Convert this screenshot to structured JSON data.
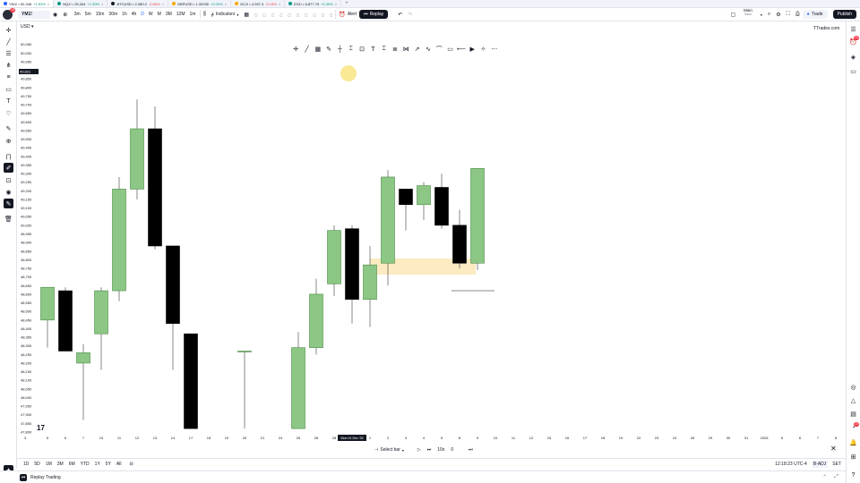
{
  "browser_tabs": [
    {
      "symbol": "YM1!",
      "price": "52,346",
      "change": "+1.83%",
      "color": "#2962ff",
      "neg": false
    },
    {
      "symbol": "NQ1!",
      "price": "25,344",
      "change": "+1.59%",
      "color": "#089981",
      "neg": false
    },
    {
      "symbol": "BTCUSD",
      "price": "2,380.2",
      "change": "-2.89%",
      "color": "#131722",
      "neg": true
    },
    {
      "symbol": "GBPUSD",
      "price": "1.32035",
      "change": "+0.02%",
      "color": "#f7a600",
      "neg": false
    },
    {
      "symbol": "GC1!",
      "price": "4,397.3",
      "change": "-0.13%",
      "color": "#f7a600",
      "neg": true
    },
    {
      "symbol": "ES1!",
      "price": "6,877.75",
      "change": "+0.39%",
      "color": "#089981",
      "neg": false
    }
  ],
  "toolbar": {
    "avatar_badge": "15",
    "symbol": "YM1!",
    "timeframes": [
      "3m",
      "5m",
      "15m",
      "30m",
      "1h",
      "4h",
      "D",
      "W",
      "M",
      "3M",
      "12M",
      "1m"
    ],
    "active_timeframe": "D",
    "indicators_label": "Indicators",
    "alert_label": "Alert",
    "replay_label": "Replay",
    "layout_name": "Main",
    "layout_sub": "Save",
    "trade_label": "Trade",
    "publish_label": "Publish"
  },
  "chart": {
    "currency": "USD",
    "watermark": "TTrades.com",
    "price_marker": "49,831",
    "date_marker": "Mon 01 Dec '25",
    "y_labels": [
      "50,050",
      "50,000",
      "49,950",
      "49,900",
      "49,850",
      "49,800",
      "49,750",
      "49,700",
      "49,650",
      "49,600",
      "49,550",
      "49,500",
      "49,450",
      "49,400",
      "49,350",
      "49,300",
      "49,250",
      "49,200",
      "49,150",
      "49,100",
      "49,050",
      "49,000",
      "48,950",
      "48,900",
      "48,850",
      "48,800",
      "48,750",
      "48,700",
      "48,650",
      "48,600",
      "48,550",
      "48,500",
      "48,450",
      "48,400",
      "48,350",
      "48,300",
      "48,250",
      "48,200",
      "48,150",
      "48,100",
      "48,050",
      "48,000",
      "47,950",
      "47,900",
      "47,850",
      "47,800"
    ],
    "x_labels": [
      "3",
      "5",
      "6",
      "7",
      "10",
      "11",
      "12",
      "13",
      "14",
      "17",
      "18",
      "19",
      "20",
      "21",
      "24",
      "25",
      "26",
      "28",
      "1",
      "2",
      "3",
      "4",
      "5",
      "8",
      "9",
      "10",
      "11",
      "12",
      "15",
      "16",
      "17",
      "18",
      "19",
      "22",
      "23",
      "24",
      "26",
      "29",
      "30",
      "31",
      "2026",
      "5",
      "6",
      "7",
      "8",
      "9"
    ],
    "x_label_positions": [
      28,
      53,
      73,
      93,
      113,
      133,
      153,
      173,
      193,
      213,
      233,
      253,
      273,
      293,
      313,
      333,
      353,
      373,
      413,
      433,
      453,
      473,
      493,
      513,
      533,
      553,
      573,
      593,
      613,
      633,
      653,
      673,
      693,
      713,
      733,
      753,
      773,
      793,
      813,
      833,
      853,
      873,
      893,
      913,
      933
    ]
  },
  "chart_data": {
    "type": "candlestick",
    "ylim": [
      47800,
      50100
    ],
    "candles": [
      {
        "open": 48450,
        "high": 48620,
        "low": 48290,
        "close": 48640,
        "bull": true
      },
      {
        "open": 48620,
        "high": 48640,
        "low": 48310,
        "close": 48270,
        "bull": false
      },
      {
        "open": 48200,
        "high": 48310,
        "low": 47870,
        "close": 48260,
        "bull": true
      },
      {
        "open": 48370,
        "high": 48640,
        "low": 48160,
        "close": 48620,
        "bull": true
      },
      {
        "open": 48620,
        "high": 49280,
        "low": 48560,
        "close": 49210,
        "bull": true
      },
      {
        "open": 49210,
        "high": 49730,
        "low": 49150,
        "close": 49560,
        "bull": true
      },
      {
        "open": 49560,
        "high": 49690,
        "low": 48860,
        "close": 48880,
        "bull": false
      },
      {
        "open": 48880,
        "high": 48880,
        "low": 48160,
        "close": 48430,
        "bull": false
      },
      {
        "open": 48370,
        "high": 48370,
        "low": 47820,
        "close": 47820,
        "bull": false
      },
      {
        "open": 48270,
        "high": 48270,
        "low": 47820,
        "close": 48270,
        "bull": true
      },
      {
        "open": 47820,
        "high": 48380,
        "low": 47820,
        "close": 48290,
        "bull": true
      },
      {
        "open": 48290,
        "high": 48690,
        "low": 48250,
        "close": 48600,
        "bull": true
      },
      {
        "open": 48660,
        "high": 49000,
        "low": 48590,
        "close": 48970,
        "bull": true
      },
      {
        "open": 48980,
        "high": 49000,
        "low": 48430,
        "close": 48570,
        "bull": false
      },
      {
        "open": 48570,
        "high": 48880,
        "low": 48410,
        "close": 48770,
        "bull": true
      },
      {
        "open": 48780,
        "high": 49320,
        "low": 48650,
        "close": 49280,
        "bull": true
      },
      {
        "open": 49210,
        "high": 49210,
        "low": 48970,
        "close": 49120,
        "bull": false
      },
      {
        "open": 49120,
        "high": 49250,
        "low": 49030,
        "close": 49230,
        "bull": true
      },
      {
        "open": 49220,
        "high": 49300,
        "low": 48980,
        "close": 49000,
        "bull": false
      },
      {
        "open": 49000,
        "high": 49090,
        "low": 48750,
        "close": 48780,
        "bull": false
      },
      {
        "open": 48780,
        "high": 49330,
        "low": 48740,
        "close": 49330,
        "bull": true
      }
    ]
  },
  "draw_tools": [
    "plus-icon",
    "trendline-icon",
    "grid-icon",
    "pen-icon",
    "cross-icon",
    "range-icon",
    "rect-icon",
    "text-icon",
    "measure-icon",
    "fib-icon",
    "pattern-icon",
    "position-icon",
    "wave-icon",
    "path-icon",
    "brush-icon",
    "note-icon",
    "ray-icon",
    "play-icon",
    "settings-icon"
  ],
  "bottom": {
    "ranges": [
      "1D",
      "5D",
      "1M",
      "3M",
      "6M",
      "YTD",
      "1Y",
      "5Y",
      "All"
    ],
    "time": "12:18:23 UTC-4",
    "adj": "B-ADJ",
    "session": "SET"
  },
  "replay": {
    "select_bar": "Select bar",
    "speed": "10x",
    "counter": "0"
  },
  "footer": {
    "label": "Replay Trading"
  },
  "right_badges": [
    "10",
    "10"
  ]
}
